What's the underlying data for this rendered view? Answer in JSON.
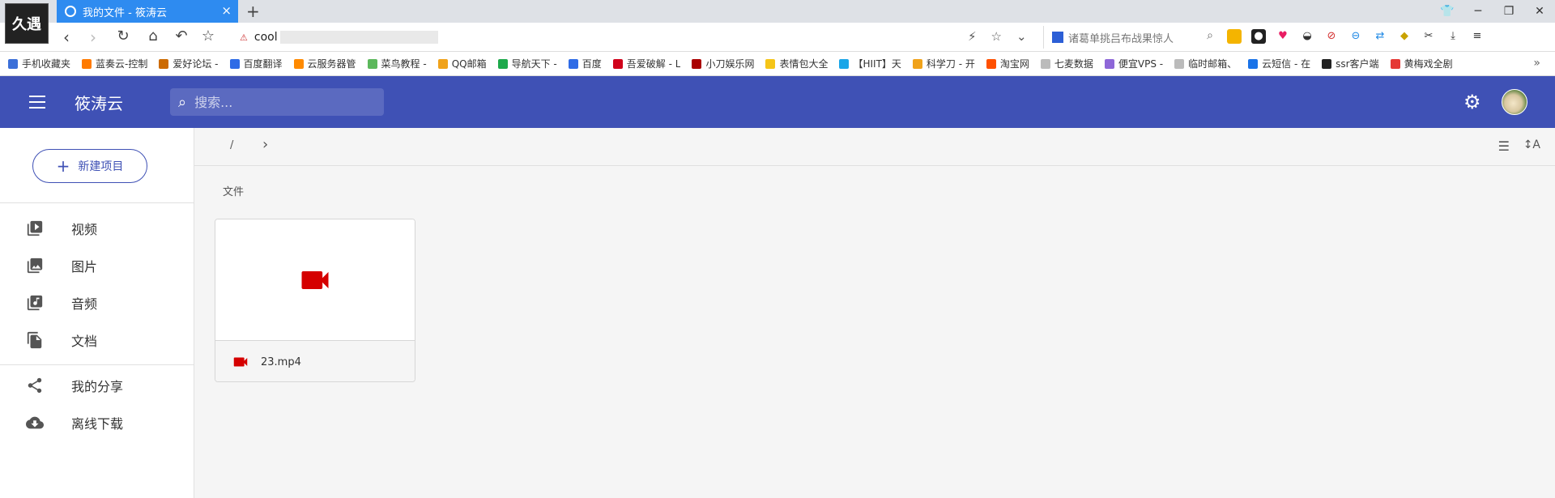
{
  "browser": {
    "tab_title": "我的文件 - 筱涛云",
    "url_visible": "cool",
    "search_placeholder": "诸葛单挑吕布战果惊人",
    "thumb_text": "久遇",
    "bookmarks": [
      {
        "label": "手机收藏夹",
        "color": "#3b6fd8"
      },
      {
        "label": "蓝奏云-控制",
        "color": "#ff7a00"
      },
      {
        "label": "爱好论坛 -",
        "color": "#cc6a00"
      },
      {
        "label": "百度翻译",
        "color": "#2e6be6"
      },
      {
        "label": "云服务器管",
        "color": "#ff8a00"
      },
      {
        "label": "菜鸟教程 -",
        "color": "#5cb85c"
      },
      {
        "label": "QQ邮箱",
        "color": "#f0a21a"
      },
      {
        "label": "导航天下 -",
        "color": "#1da94b"
      },
      {
        "label": "百度",
        "color": "#2e6be6"
      },
      {
        "label": "吾爱破解 - L",
        "color": "#d0021b"
      },
      {
        "label": "小刀娱乐网",
        "color": "#a00"
      },
      {
        "label": "表情包大全",
        "color": "#f5c518"
      },
      {
        "label": "【HIIT】天",
        "color": "#1aa6e8"
      },
      {
        "label": "科学刀 - 开",
        "color": "#f0a21a"
      },
      {
        "label": "淘宝网",
        "color": "#ff5000"
      },
      {
        "label": "七麦数据",
        "color": "#bbbbbb"
      },
      {
        "label": "便宜VPS -",
        "color": "#8e67d8"
      },
      {
        "label": "临时邮箱、",
        "color": "#bbbbbb"
      },
      {
        "label": "云短信 - 在",
        "color": "#1a73e8"
      },
      {
        "label": "ssr客户端",
        "color": "#222222"
      },
      {
        "label": "黄梅戏全剧",
        "color": "#e53935"
      }
    ]
  },
  "app": {
    "title": "筱涛云",
    "search_placeholder": "搜索...",
    "new_button_label": "新建项目",
    "nav": [
      {
        "label": "视频",
        "icon": "video-library-icon"
      },
      {
        "label": "图片",
        "icon": "photo-library-icon"
      },
      {
        "label": "音频",
        "icon": "music-library-icon"
      },
      {
        "label": "文档",
        "icon": "documents-icon"
      },
      {
        "label": "我的分享",
        "icon": "share-icon"
      },
      {
        "label": "离线下载",
        "icon": "cloud-download-icon"
      }
    ],
    "breadcrumb_root": "/",
    "section_title": "文件",
    "files": [
      {
        "name": "23.mp4",
        "type": "video",
        "icon_color": "#d50000"
      }
    ]
  }
}
